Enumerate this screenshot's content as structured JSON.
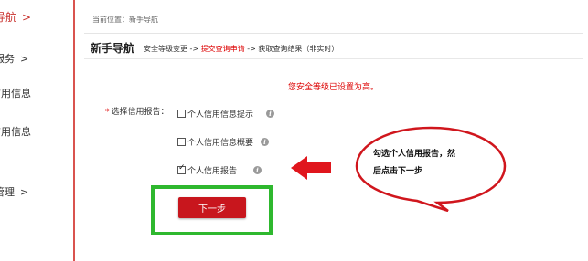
{
  "sidebar": {
    "items": [
      {
        "label": "导航",
        "chevron": ">"
      },
      {
        "label": "服务",
        "chevron": ">"
      },
      {
        "label": "信用信息"
      },
      {
        "label": "信用信息"
      },
      {
        "label": "管理",
        "chevron": ">"
      }
    ],
    "accent_color": "#d9534f"
  },
  "breadcrumb": "当前位置：新手导航",
  "header": {
    "title": "新手导航",
    "steps": {
      "step1": "安全等级变更 ->",
      "step2": "提交查询申请",
      "step3": "-> 获取查询结果（非实时）"
    }
  },
  "notice": "您安全等级已设置为高。",
  "form": {
    "required_mark": "*",
    "label": "选择信用报告：",
    "options": [
      {
        "label": "个人信用信息提示",
        "checked": false
      },
      {
        "label": "个人信用信息概要",
        "checked": false
      },
      {
        "label": "个人信用报告",
        "checked": true
      }
    ],
    "info_icon": "i"
  },
  "next_button": {
    "label": "下一步",
    "color": "#c8161d"
  },
  "annotation": {
    "line1": "勾选个人信用报告，然",
    "line2": "后点击下一步",
    "highlight_color": "#2eb82e",
    "arrow_color": "#e0161d"
  }
}
